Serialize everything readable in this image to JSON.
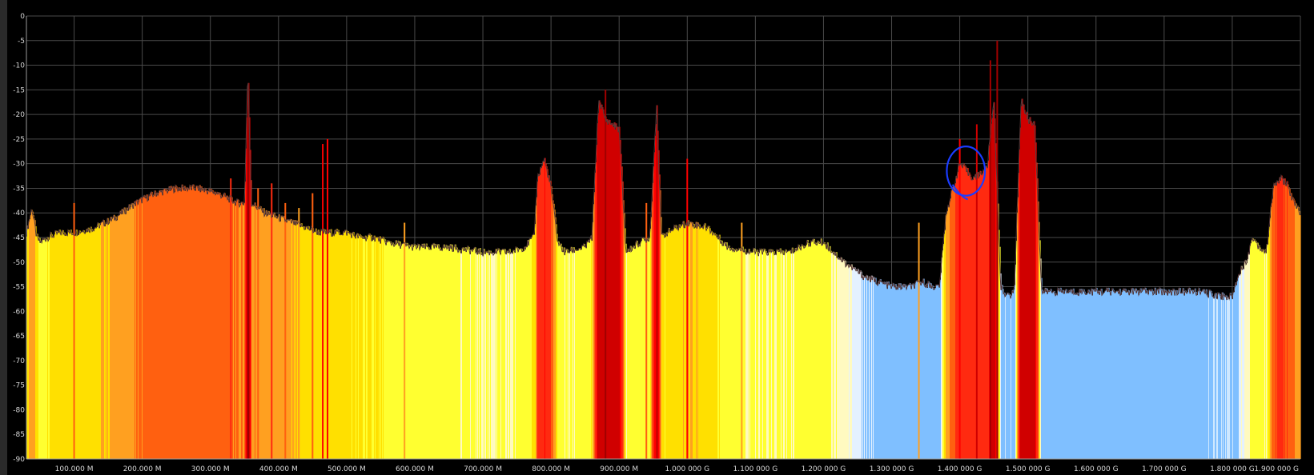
{
  "chart_data": {
    "type": "area",
    "title": "",
    "xlabel": "",
    "ylabel": "",
    "x_unit": "Hz",
    "xlim": [
      30000000,
      1900000000
    ],
    "ylim": [
      -90,
      0
    ],
    "grid": true,
    "legend": "none",
    "y_ticks": [
      {
        "value": 0,
        "label": "0"
      },
      {
        "value": -5,
        "label": "-5"
      },
      {
        "value": -10,
        "label": "-10"
      },
      {
        "value": -15,
        "label": "-15"
      },
      {
        "value": -20,
        "label": "-20"
      },
      {
        "value": -25,
        "label": "-25"
      },
      {
        "value": -30,
        "label": "-30"
      },
      {
        "value": -35,
        "label": "-35"
      },
      {
        "value": -40,
        "label": "-40"
      },
      {
        "value": -45,
        "label": "-45"
      },
      {
        "value": -50,
        "label": "-50"
      },
      {
        "value": -55,
        "label": "-55"
      },
      {
        "value": -60,
        "label": "-60"
      },
      {
        "value": -65,
        "label": "-65"
      },
      {
        "value": -70,
        "label": "-70"
      },
      {
        "value": -75,
        "label": "-75"
      },
      {
        "value": -80,
        "label": "-80"
      },
      {
        "value": -85,
        "label": "-85"
      },
      {
        "value": -90,
        "label": "-90"
      }
    ],
    "x_ticks": [
      {
        "value": 100000000,
        "label": "100.000 M"
      },
      {
        "value": 200000000,
        "label": "200.000 M"
      },
      {
        "value": 300000000,
        "label": "300.000 M"
      },
      {
        "value": 400000000,
        "label": "400.000 M"
      },
      {
        "value": 500000000,
        "label": "500.000 M"
      },
      {
        "value": 600000000,
        "label": "600.000 M"
      },
      {
        "value": 700000000,
        "label": "700.000 M"
      },
      {
        "value": 800000000,
        "label": "800.000 M"
      },
      {
        "value": 900000000,
        "label": "900.000 M"
      },
      {
        "value": 1000000000,
        "label": "1.000 000 G"
      },
      {
        "value": 1100000000,
        "label": "1.100 000 G"
      },
      {
        "value": 1200000000,
        "label": "1.200 000 G"
      },
      {
        "value": 1300000000,
        "label": "1.300 000 G"
      },
      {
        "value": 1400000000,
        "label": "1.400 000 G"
      },
      {
        "value": 1500000000,
        "label": "1.500 000 G"
      },
      {
        "value": 1600000000,
        "label": "1.600 000 G"
      },
      {
        "value": 1700000000,
        "label": "1.700 000 G"
      },
      {
        "value": 1800000000,
        "label": "1.800 000 G"
      },
      {
        "value": 1900000000,
        "label": "1.900 000 G"
      }
    ],
    "colormap": [
      {
        "level": -90,
        "color": "#cfe8ff"
      },
      {
        "level": -57,
        "color": "#7fbfff"
      },
      {
        "level": -53,
        "color": "#e4f1ff"
      },
      {
        "level": -51,
        "color": "#fffac0"
      },
      {
        "level": -48,
        "color": "#ffff30"
      },
      {
        "level": -45,
        "color": "#ffe000"
      },
      {
        "level": -42,
        "color": "#ffa020"
      },
      {
        "level": -38,
        "color": "#ff6010"
      },
      {
        "level": -34,
        "color": "#ff2a10"
      },
      {
        "level": -29,
        "color": "#ff0000"
      },
      {
        "level": -24,
        "color": "#d00000"
      },
      {
        "level": -15,
        "color": "#a00000"
      }
    ],
    "series": [
      {
        "x": [
          30000000,
          38000000,
          45000000,
          50000000,
          60000000,
          80000000,
          100000000,
          130000000,
          160000000,
          190000000,
          220000000,
          250000000,
          280000000,
          310000000,
          340000000,
          350000000,
          355000000,
          360000000,
          380000000,
          400000000,
          420000000,
          440000000,
          460000000,
          480000000,
          500000000,
          520000000,
          540000000,
          560000000,
          600000000,
          650000000,
          700000000,
          740000000,
          760000000,
          775000000,
          780000000,
          790000000,
          800000000,
          810000000,
          820000000,
          850000000,
          860000000,
          870000000,
          880000000,
          890000000,
          900000000,
          910000000,
          930000000,
          945000000,
          955000000,
          962000000,
          970000000,
          1000000000,
          1030000000,
          1060000000,
          1100000000,
          1150000000,
          1180000000,
          1200000000,
          1230000000,
          1260000000,
          1300000000,
          1330000000,
          1345000000,
          1360000000,
          1370000000,
          1380000000,
          1400000000,
          1420000000,
          1440000000,
          1450000000,
          1460000000,
          1470000000,
          1480000000,
          1490000000,
          1500000000,
          1510000000,
          1520000000,
          1550000000,
          1600000000,
          1650000000,
          1700000000,
          1750000000,
          1790000000,
          1800000000,
          1810000000,
          1820000000,
          1830000000,
          1840000000,
          1850000000,
          1860000000,
          1870000000,
          1880000000,
          1890000000,
          1900000000
        ],
        "y": [
          -44,
          -39,
          -45,
          -46,
          -45,
          -44,
          -44,
          -43,
          -41,
          -38,
          -36,
          -35,
          -35,
          -36,
          -38,
          -38,
          -11,
          -38,
          -40,
          -41,
          -42,
          -43,
          -44,
          -44,
          -44,
          -45,
          -45,
          -46,
          -47,
          -47,
          -48,
          -48,
          -47,
          -45,
          -33,
          -29,
          -35,
          -46,
          -48,
          -47,
          -45,
          -17,
          -21,
          -22,
          -23,
          -48,
          -46,
          -45,
          -18,
          -45,
          -44,
          -42,
          -43,
          -47,
          -48,
          -48,
          -46,
          -46,
          -50,
          -53,
          -55,
          -55,
          -54,
          -55,
          -55,
          -40,
          -30,
          -33,
          -31,
          -17,
          -55,
          -57,
          -56,
          -17,
          -21,
          -22,
          -56,
          -56,
          -56,
          -56,
          -56,
          -56,
          -57,
          -57,
          -52,
          -50,
          -45,
          -47,
          -48,
          -35,
          -33,
          -34,
          -38,
          -40
        ]
      }
    ],
    "spurs": [
      {
        "x": 100000000,
        "y": -38
      },
      {
        "x": 300000000,
        "y": -36
      },
      {
        "x": 330000000,
        "y": -33
      },
      {
        "x": 370000000,
        "y": -35
      },
      {
        "x": 390000000,
        "y": -34
      },
      {
        "x": 410000000,
        "y": -38
      },
      {
        "x": 430000000,
        "y": -39
      },
      {
        "x": 450000000,
        "y": -36
      },
      {
        "x": 465000000,
        "y": -26
      },
      {
        "x": 472000000,
        "y": -25
      },
      {
        "x": 585000000,
        "y": -42
      },
      {
        "x": 880000000,
        "y": -15
      },
      {
        "x": 940000000,
        "y": -38
      },
      {
        "x": 1000000000,
        "y": -29
      },
      {
        "x": 1080000000,
        "y": -42
      },
      {
        "x": 1340000000,
        "y": -42
      },
      {
        "x": 1400000000,
        "y": -25
      },
      {
        "x": 1425000000,
        "y": -22
      },
      {
        "x": 1445000000,
        "y": -9
      },
      {
        "x": 1455000000,
        "y": -5
      }
    ],
    "annotations": [
      {
        "shape": "ellipse",
        "color": "#1a3cff",
        "x": 1409000000,
        "y": -31.5,
        "rx_hz": 28000000,
        "ry_db": 5
      }
    ]
  }
}
